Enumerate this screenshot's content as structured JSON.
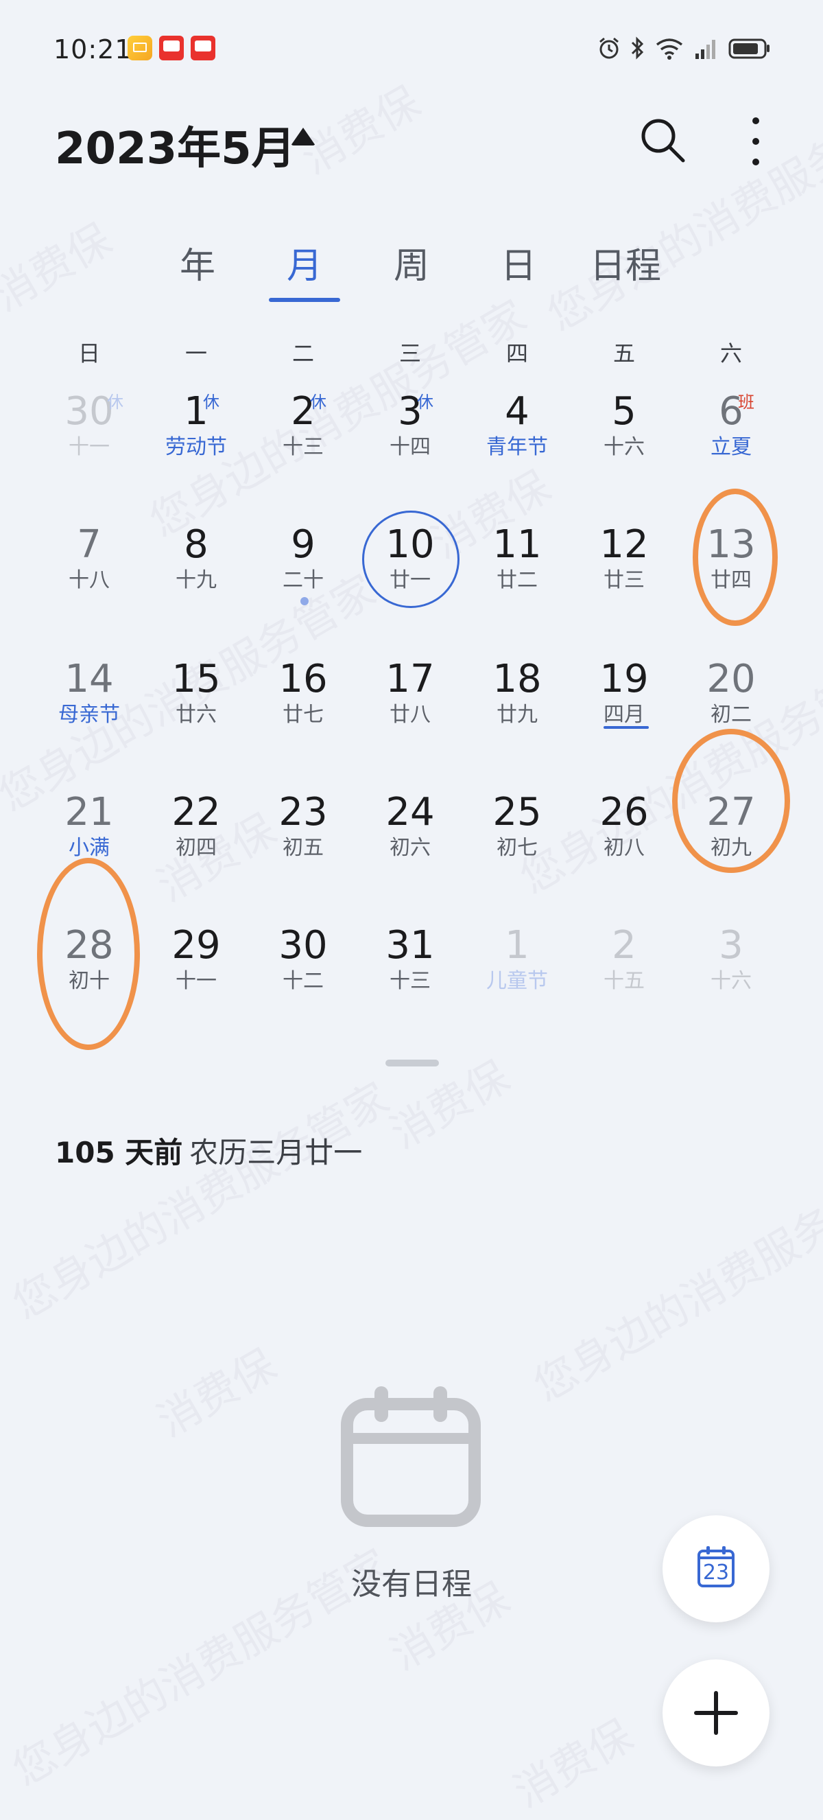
{
  "status_bar": {
    "time": "10:21"
  },
  "header": {
    "month_title": "2023年5月"
  },
  "tabs": [
    {
      "label": "年"
    },
    {
      "label": "月"
    },
    {
      "label": "周"
    },
    {
      "label": "日"
    },
    {
      "label": "日程"
    }
  ],
  "weekdays": [
    "日",
    "一",
    "二",
    "三",
    "四",
    "五",
    "六"
  ],
  "weeks": [
    [
      {
        "day": "30",
        "sub": "十一",
        "badge": "休",
        "state": "muted"
      },
      {
        "day": "1",
        "sub": "劳动节",
        "badge": "休",
        "holiday": true
      },
      {
        "day": "2",
        "sub": "十三",
        "badge": "休"
      },
      {
        "day": "3",
        "sub": "十四",
        "badge": "休"
      },
      {
        "day": "4",
        "sub": "青年节",
        "holiday": true
      },
      {
        "day": "5",
        "sub": "十六"
      },
      {
        "day": "6",
        "sub": "立夏",
        "badge": "班",
        "holiday": true,
        "state": "gray"
      }
    ],
    [
      {
        "day": "7",
        "sub": "十八",
        "state": "gray"
      },
      {
        "day": "8",
        "sub": "十九"
      },
      {
        "day": "9",
        "sub": "二十"
      },
      {
        "day": "10",
        "sub": "廿一"
      },
      {
        "day": "11",
        "sub": "廿二"
      },
      {
        "day": "12",
        "sub": "廿三"
      },
      {
        "day": "13",
        "sub": "廿四",
        "state": "gray"
      }
    ],
    [
      {
        "day": "14",
        "sub": "母亲节",
        "holiday": true,
        "state": "gray"
      },
      {
        "day": "15",
        "sub": "廿六"
      },
      {
        "day": "16",
        "sub": "廿七"
      },
      {
        "day": "17",
        "sub": "廿八"
      },
      {
        "day": "18",
        "sub": "廿九"
      },
      {
        "day": "19",
        "sub": "四月"
      },
      {
        "day": "20",
        "sub": "初二",
        "state": "gray"
      }
    ],
    [
      {
        "day": "21",
        "sub": "小满",
        "holiday": true,
        "state": "gray"
      },
      {
        "day": "22",
        "sub": "初四"
      },
      {
        "day": "23",
        "sub": "初五"
      },
      {
        "day": "24",
        "sub": "初六"
      },
      {
        "day": "25",
        "sub": "初七"
      },
      {
        "day": "26",
        "sub": "初八"
      },
      {
        "day": "27",
        "sub": "初九",
        "state": "gray"
      }
    ],
    [
      {
        "day": "28",
        "sub": "初十",
        "state": "gray"
      },
      {
        "day": "29",
        "sub": "十一"
      },
      {
        "day": "30",
        "sub": "十二"
      },
      {
        "day": "31",
        "sub": "十三"
      },
      {
        "day": "1",
        "sub": "儿童节",
        "holiday": true,
        "state": "muted"
      },
      {
        "day": "2",
        "sub": "十五",
        "state": "muted"
      },
      {
        "day": "3",
        "sub": "十六",
        "state": "muted"
      }
    ]
  ],
  "info": {
    "days_ago": "105 天前",
    "lunar": "农历三月廿一"
  },
  "empty_state": {
    "text": "没有日程"
  },
  "fab_today": {
    "day": "23"
  },
  "colors": {
    "accent": "#3868d3",
    "annotation": "#f0924a",
    "work_day": "#d8432f"
  }
}
